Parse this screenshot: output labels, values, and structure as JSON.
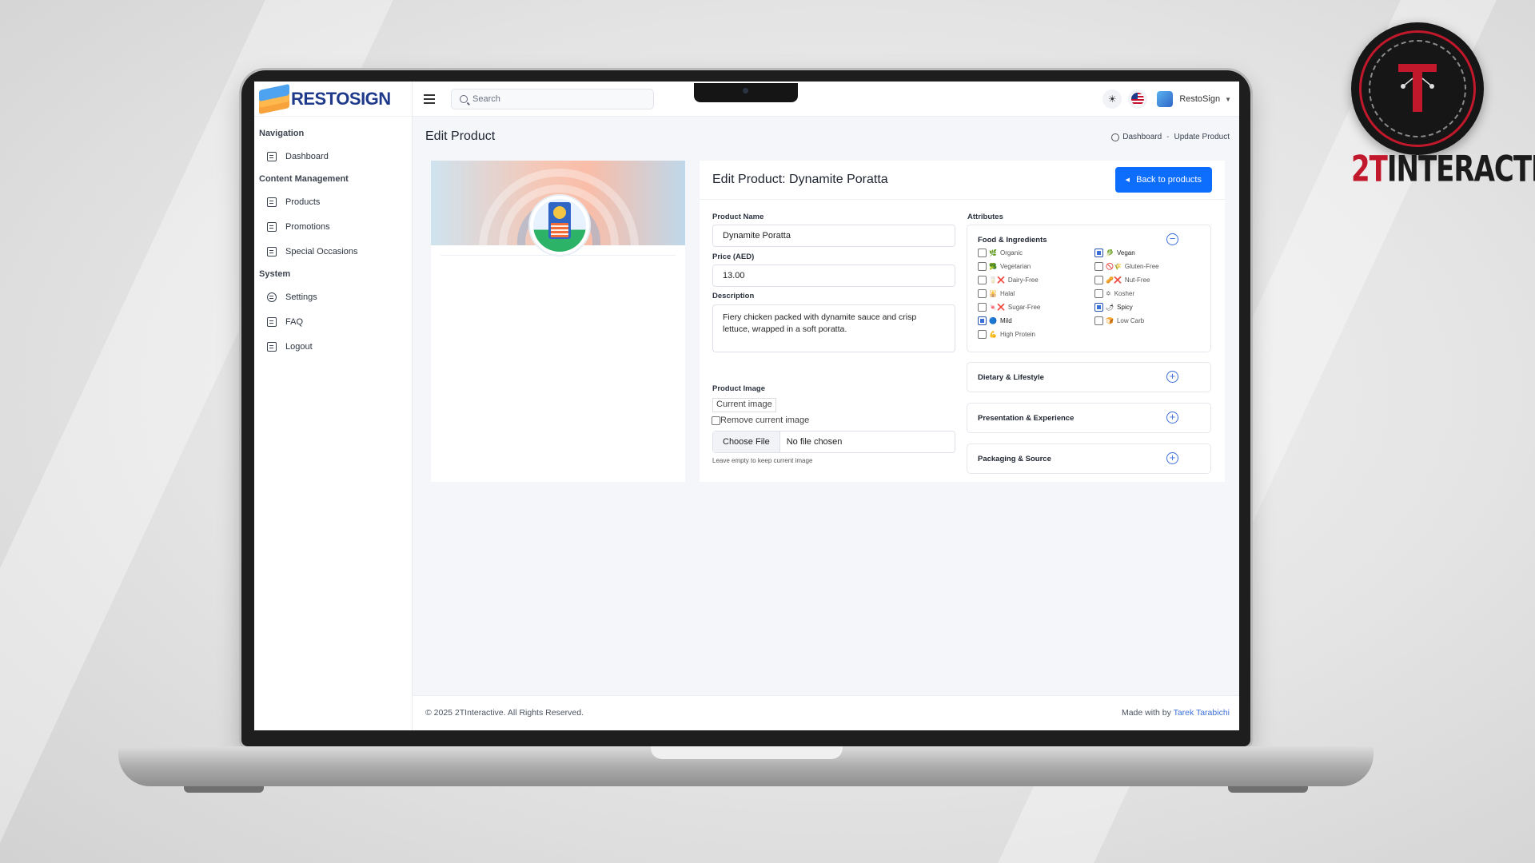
{
  "brand": {
    "logo_text": "RESTOSIGN",
    "badge_text_prefix": "2T",
    "badge_text_rest": "INTERACTIVE",
    "colors": {
      "primary": "#0d6efd",
      "logo": "#1f3a8a",
      "badge_red": "#c2182b"
    }
  },
  "sidebar": {
    "sections": [
      {
        "heading": "Navigation",
        "items": [
          {
            "label": "Dashboard",
            "icon": "grid-icon"
          }
        ]
      },
      {
        "heading": "Content Management",
        "items": [
          {
            "label": "Products",
            "icon": "box-icon"
          },
          {
            "label": "Promotions",
            "icon": "tag-icon"
          },
          {
            "label": "Special Occasions",
            "icon": "calendar-icon"
          }
        ]
      },
      {
        "heading": "System",
        "items": [
          {
            "label": "Settings",
            "icon": "gear-icon"
          },
          {
            "label": "FAQ",
            "icon": "book-icon"
          },
          {
            "label": "Logout",
            "icon": "logout-icon"
          }
        ]
      }
    ]
  },
  "topbar": {
    "search_placeholder": "Search",
    "theme_icon": "sun-icon",
    "language_icon": "us-flag-icon",
    "user_name": "RestoSign"
  },
  "page": {
    "title": "Edit Product",
    "breadcrumb": {
      "home": "Dashboard",
      "sep": "-",
      "current": "Update Product"
    }
  },
  "form": {
    "title": "Edit Product: Dynamite Poratta",
    "back_button": "Back to products",
    "name_label": "Product Name",
    "name_value": "Dynamite Poratta",
    "price_label": "Price (AED)",
    "price_value": "13.00",
    "description_label": "Description",
    "description_value": "Fiery chicken packed with dynamite sauce and crisp lettuce, wrapped in a soft poratta.",
    "image_label": "Product Image",
    "image_alt": "Current image",
    "remove_label": "Remove current image",
    "file_button": "Choose File",
    "file_status": "No file chosen",
    "file_help": "Leave empty to keep current image"
  },
  "attributes": {
    "label": "Attributes",
    "groups": [
      {
        "title": "Food & Ingredients",
        "expanded": true,
        "toggle": "−",
        "options": [
          {
            "label": "Organic",
            "emoji": "🌿",
            "checked": false
          },
          {
            "label": "Vegan",
            "emoji": "🥬",
            "checked": true
          },
          {
            "label": "Vegetarian",
            "emoji": "🥦",
            "checked": false
          },
          {
            "label": "Gluten-Free",
            "emoji": "🚫🌾",
            "checked": false
          },
          {
            "label": "Dairy-Free",
            "emoji": "🥛❌",
            "checked": false
          },
          {
            "label": "Nut-Free",
            "emoji": "🥜❌",
            "checked": false
          },
          {
            "label": "Halal",
            "emoji": "🕌",
            "checked": false
          },
          {
            "label": "Kosher",
            "emoji": "✡",
            "checked": false
          },
          {
            "label": "Sugar-Free",
            "emoji": "🍬❌",
            "checked": false
          },
          {
            "label": "Spicy",
            "emoji": "🌶",
            "checked": true
          },
          {
            "label": "Mild",
            "emoji": "🔵",
            "checked": true
          },
          {
            "label": "Low Carb",
            "emoji": "🍞",
            "checked": false
          },
          {
            "label": "High Protein",
            "emoji": "💪",
            "checked": false
          }
        ]
      },
      {
        "title": "Dietary & Lifestyle",
        "expanded": false,
        "toggle": "+"
      },
      {
        "title": "Presentation & Experience",
        "expanded": false,
        "toggle": "+"
      },
      {
        "title": "Packaging & Source",
        "expanded": false,
        "toggle": "+"
      }
    ]
  },
  "footer": {
    "copyright": "© 2025 2TInteractive. All Rights Reserved.",
    "made_with": "Made with by",
    "author": "Tarek Tarabichi"
  }
}
